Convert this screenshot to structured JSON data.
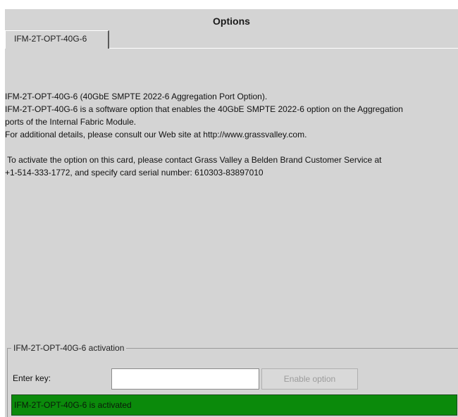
{
  "window": {
    "title": "Options"
  },
  "tabs": [
    {
      "label": "IFM-2T-OPT-40G-6"
    }
  ],
  "description": {
    "lines": [
      "IFM-2T-OPT-40G-6 (40GbE SMPTE 2022-6 Aggregation Port Option).",
      "IFM-2T-OPT-40G-6 is a software option that enables the 40GbE SMPTE 2022-6 option on the Aggregation",
      "ports of the Internal Fabric Module.",
      "For additional details, please consult our Web site at http://www.grassvalley.com.",
      " To activate the option on this card, please contact Grass Valley a Belden Brand Customer Service at",
      "+1-514-333-1772, and specify card serial number: 610303-83897010"
    ]
  },
  "activation": {
    "legend": "IFM-2T-OPT-40G-6 activation",
    "key_label": "Enter key:",
    "key_value": "",
    "key_placeholder": "",
    "enable_button": "Enable option",
    "status_text": "IFM-2T-OPT-40G-6 is activated",
    "status_color": "#0b8a0b"
  }
}
